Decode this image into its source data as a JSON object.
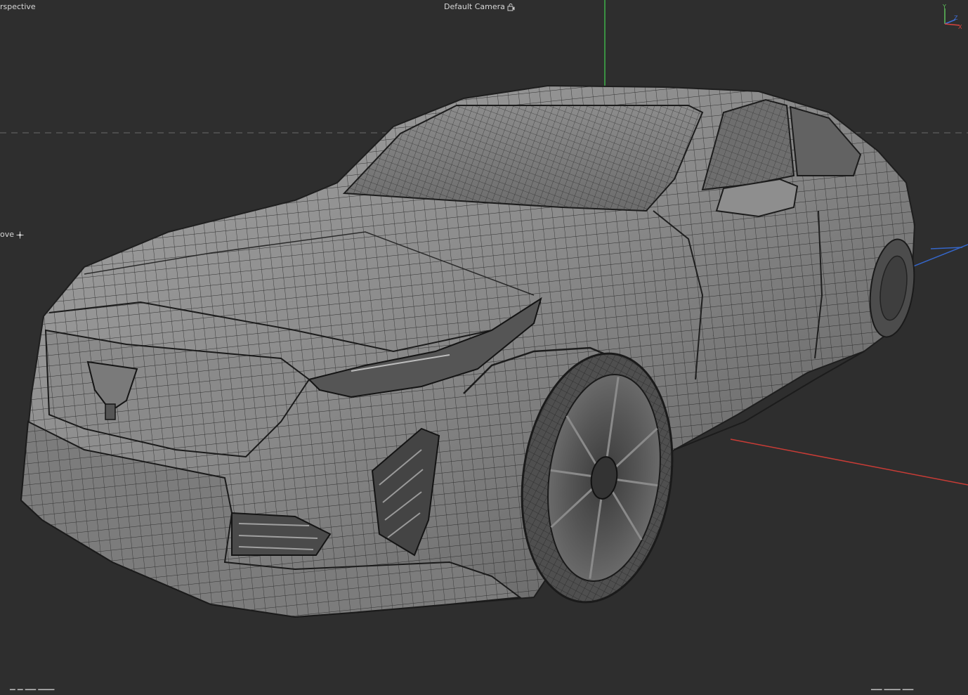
{
  "viewport": {
    "view_name": "rspective",
    "camera_label": "Default Camera",
    "camera_icon": "camera-lock-icon",
    "tool_label": "ove",
    "tool_icon": "move-crosshair-icon"
  },
  "gizmo": {
    "axes": [
      "Y",
      "Z",
      "X"
    ],
    "colors": {
      "x": "#d8433e",
      "y": "#5ec05a",
      "z": "#3f6fd8"
    }
  },
  "colors": {
    "background": "#2e2e2e",
    "wire": "#222222",
    "surface_light": "#9a9a9a",
    "surface_dark": "#4a4a4a",
    "axis_x": "#c83c36",
    "axis_y": "#3fb04a",
    "axis_z": "#3566c9",
    "horizon": "#6a6a6a"
  }
}
